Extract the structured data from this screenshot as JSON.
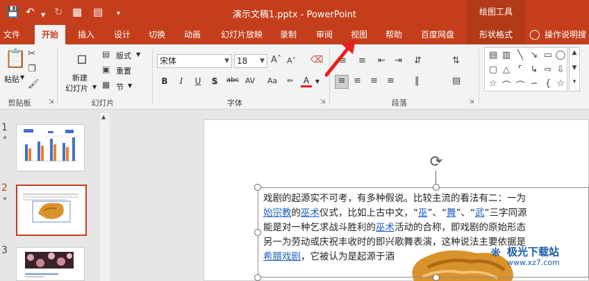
{
  "titlebar": {
    "title": "演示文稿1.pptx  -  PowerPoint",
    "drawing_tools": "绘图工具"
  },
  "tabs": [
    "文件",
    "开始",
    "插入",
    "设计",
    "切换",
    "动画",
    "幻灯片放映",
    "录制",
    "审阅",
    "视图",
    "帮助",
    "百度网盘",
    "形状格式",
    "操作说明搜"
  ],
  "ribbon": {
    "clipboard": {
      "paste": "粘贴",
      "label": "剪贴板"
    },
    "slides": {
      "new_slide_1": "新建",
      "new_slide_2": "幻灯片",
      "layout": "版式",
      "reset": "重置",
      "section": "节",
      "label": "幻灯片"
    },
    "font": {
      "font_name": "宋体",
      "font_size": "18",
      "label": "字体"
    },
    "paragraph": {
      "label": "段落"
    }
  },
  "thumbnails": [
    {
      "num": "1"
    },
    {
      "num": "2"
    },
    {
      "num": "3"
    }
  ],
  "slide": {
    "line1": "戏剧的起源实不可考，有多种假说。比较主流的看法有二：一为",
    "line2_link1": "始宗教",
    "line2_mid1": "的",
    "line2_link2": "巫术",
    "line2_mid2": "仪式，比如上古中文，“",
    "line2_link3": "巫",
    "line2_mid3": "”、“",
    "line2_link4": "舞",
    "line2_mid4": "”、“",
    "line2_link5": "武",
    "line2_end": "”三字同源",
    "line3_pre": "能是对一种乞求战斗胜利的",
    "line3_link": "巫术",
    "line3_end": "活动的合称，即戏剧的原始形态",
    "line4": "另一为劳动或庆祝丰收时的即兴歌舞表演，这种说法主要依据是",
    "line5_link": "希腊戏剧",
    "line5_end": "，它被认为是起源于酒"
  },
  "watermark": {
    "text": "极光下载站",
    "url": "www.xz7.com"
  },
  "colors": {
    "accent": "#c43e1c",
    "link": "#1f5fbf",
    "arrow": "#e8201e"
  }
}
